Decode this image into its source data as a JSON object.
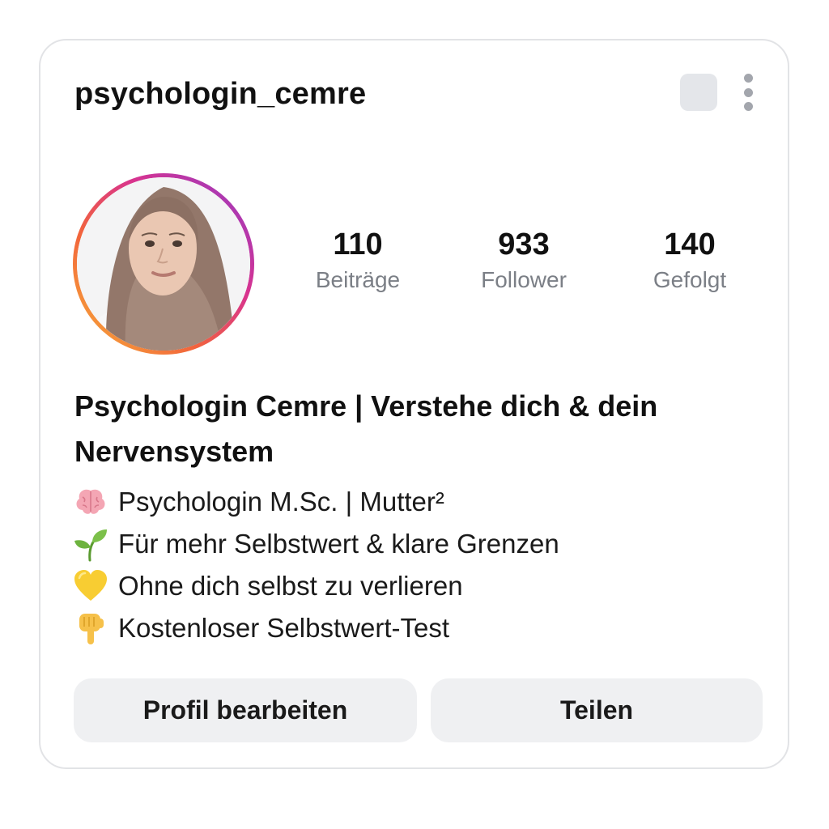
{
  "profile": {
    "username": "psychologin_cemre",
    "name_line": "Psychologin Cemre | Verstehe dich & dein Nervensystem"
  },
  "stats": {
    "posts": {
      "value": "110",
      "label": "Beiträge"
    },
    "followers": {
      "value": "933",
      "label": "Follower"
    },
    "following": {
      "value": "140",
      "label": "Gefolgt"
    }
  },
  "bio": {
    "lines": [
      {
        "icon": "brain-icon",
        "text": "Psychologin M.Sc. | Mutter²"
      },
      {
        "icon": "seedling-icon",
        "text": "Für mehr Selbstwert & klare Grenzen"
      },
      {
        "icon": "yellow-heart-icon",
        "text": "Ohne dich selbst zu verlieren"
      },
      {
        "icon": "pointing-down-icon",
        "text": "Kostenloser Selbstwert-Test"
      }
    ]
  },
  "actions": {
    "edit_label": "Profil bearbeiten",
    "share_label": "Teilen"
  },
  "icons": {
    "square": "square-icon",
    "more": "more-vertical-icon"
  },
  "colors": {
    "label_gray": "#7b7f86",
    "button_bg": "#eff0f2",
    "ring_gradient": [
      "#f7b23a",
      "#f2643b",
      "#d8338f",
      "#8f3cc9"
    ]
  }
}
